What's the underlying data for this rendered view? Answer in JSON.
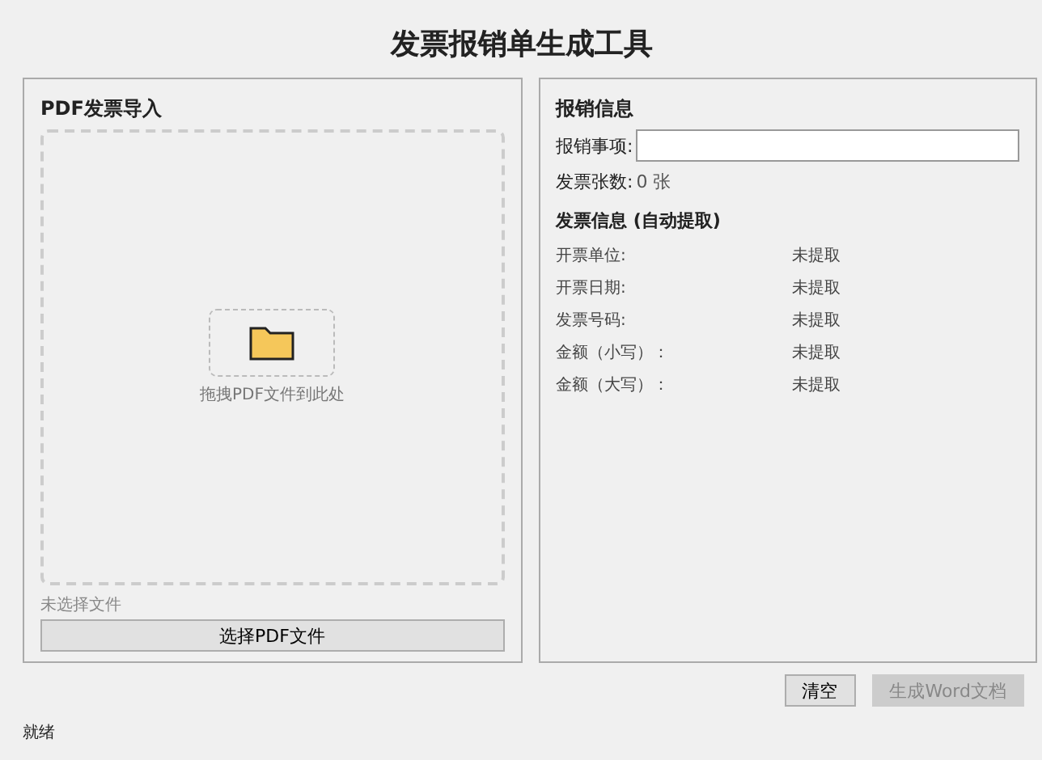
{
  "window": {
    "title": "发票报销单生成工具"
  },
  "import_panel": {
    "title": "PDF发票导入",
    "drop_hint": "拖拽PDF文件到此处",
    "file_status": "未选择文件",
    "select_button": "选择PDF文件"
  },
  "info_panel": {
    "title": "报销信息",
    "item_label": "报销事项:",
    "count_label": "发票张数:",
    "count_value": "0 张",
    "section_title": "发票信息 (自动提取)",
    "fields": [
      {
        "label": "开票单位:",
        "value": "未提取"
      },
      {
        "label": "开票日期:",
        "value": "未提取"
      },
      {
        "label": "发票号码:",
        "value": "未提取"
      },
      {
        "label": "金额（小写）：",
        "value": "未提取"
      },
      {
        "label": "金额（大写）：",
        "value": "未提取"
      }
    ]
  },
  "actions": [
    {
      "label": "清空",
      "disabled": false
    },
    {
      "label": "生成Word文档",
      "disabled": true
    }
  ],
  "status_bar": {
    "text": "就绪"
  }
}
